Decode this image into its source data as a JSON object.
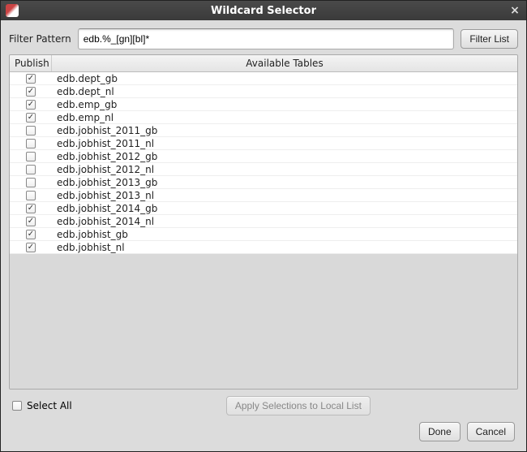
{
  "window": {
    "title": "Wildcard Selector"
  },
  "filter": {
    "label": "Filter Pattern",
    "value": "edb.%_[gn][bl]*",
    "button": "Filter List"
  },
  "table": {
    "headers": {
      "publish": "Publish",
      "available": "Available Tables"
    },
    "rows": [
      {
        "checked": true,
        "name": "edb.dept_gb"
      },
      {
        "checked": true,
        "name": "edb.dept_nl"
      },
      {
        "checked": true,
        "name": "edb.emp_gb"
      },
      {
        "checked": true,
        "name": "edb.emp_nl"
      },
      {
        "checked": false,
        "name": "edb.jobhist_2011_gb"
      },
      {
        "checked": false,
        "name": "edb.jobhist_2011_nl"
      },
      {
        "checked": false,
        "name": "edb.jobhist_2012_gb"
      },
      {
        "checked": false,
        "name": "edb.jobhist_2012_nl"
      },
      {
        "checked": false,
        "name": "edb.jobhist_2013_gb"
      },
      {
        "checked": false,
        "name": "edb.jobhist_2013_nl"
      },
      {
        "checked": true,
        "name": "edb.jobhist_2014_gb"
      },
      {
        "checked": true,
        "name": "edb.jobhist_2014_nl"
      },
      {
        "checked": true,
        "name": "edb.jobhist_gb"
      },
      {
        "checked": true,
        "name": "edb.jobhist_nl"
      }
    ]
  },
  "footer": {
    "select_all": "Select All",
    "select_all_checked": false,
    "apply": "Apply Selections to Local List",
    "apply_enabled": false,
    "done": "Done",
    "cancel": "Cancel"
  }
}
